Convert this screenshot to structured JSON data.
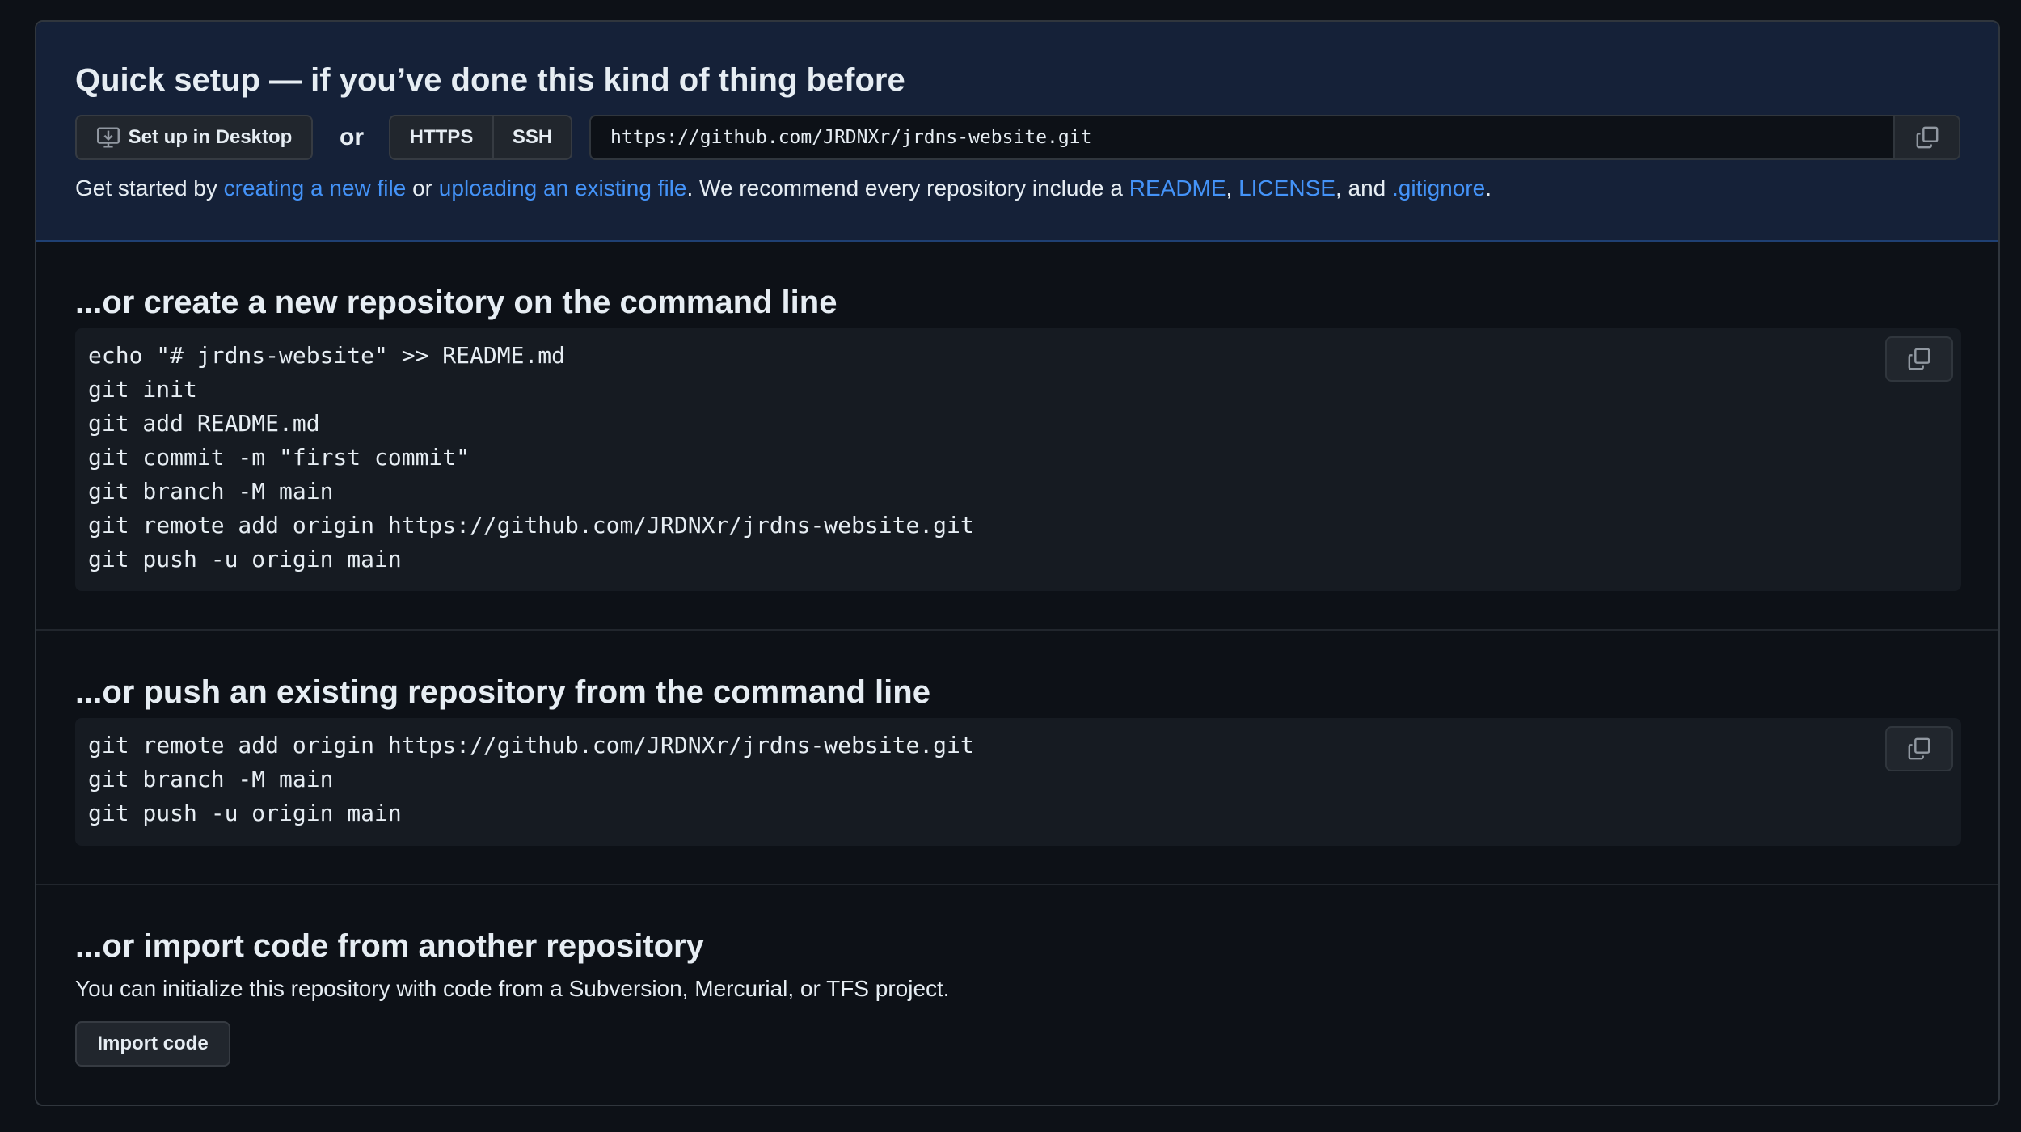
{
  "quick_setup": {
    "title": "Quick setup — if you’ve done this kind of thing before",
    "desktop_button": "Set up in Desktop",
    "or_label": "or",
    "protocols": [
      "HTTPS",
      "SSH"
    ],
    "selected_protocol": "HTTPS",
    "clone_url": "https://github.com/JRDNXr/jrdns-website.git",
    "hint": {
      "prefix": "Get started by ",
      "link_new_file": "creating a new file",
      "connector_or": " or ",
      "link_upload": "uploading an existing file",
      "middle": ". We recommend every repository include a ",
      "link_readme": "README",
      "comma1": ", ",
      "link_license": "LICENSE",
      "and_text": ", and ",
      "link_gitignore": ".gitignore",
      "suffix": "."
    }
  },
  "new_repo": {
    "title": "...or create a new repository on the command line",
    "lines": [
      "echo \"# jrdns-website\" >> README.md",
      "git init",
      "git add README.md",
      "git commit -m \"first commit\"",
      "git branch -M main",
      "git remote add origin https://github.com/JRDNXr/jrdns-website.git",
      "git push -u origin main"
    ]
  },
  "push_existing": {
    "title": "...or push an existing repository from the command line",
    "lines": [
      "git remote add origin https://github.com/JRDNXr/jrdns-website.git",
      "git branch -M main",
      "git push -u origin main"
    ]
  },
  "import_code": {
    "title": "...or import code from another repository",
    "description": "You can initialize this repository with code from a Subversion, Mercurial, or TFS project.",
    "button": "Import code"
  },
  "colors": {
    "link": "#4493f8",
    "quick_bg": "#152138",
    "page_bg": "#0d1117",
    "code_bg": "#161b22"
  },
  "icons": {
    "desktop": "desktop-download-icon",
    "copy": "copy-icon"
  }
}
